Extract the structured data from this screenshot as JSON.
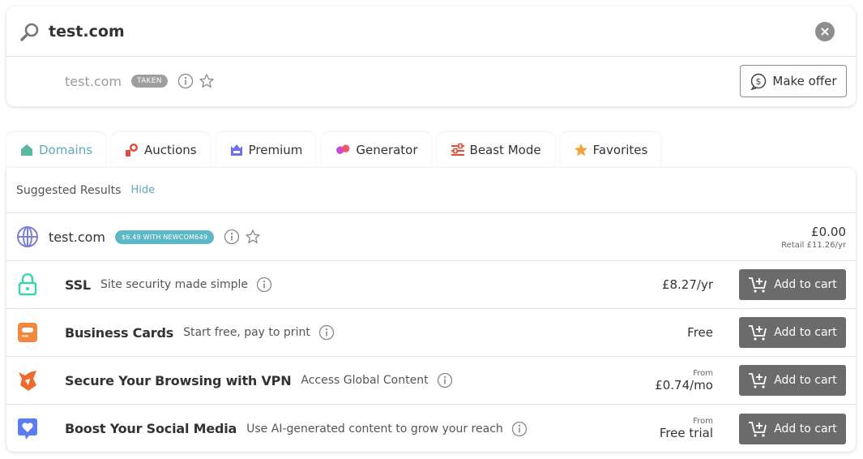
{
  "search": {
    "query": "test.com",
    "icons": {
      "search": "search-icon",
      "clear": "clear-icon"
    }
  },
  "exact_match": {
    "domain": "test.com",
    "status_badge": "TAKEN",
    "make_offer_label": "Make offer"
  },
  "tabs": [
    {
      "label": "Domains",
      "icon": "home-icon",
      "active": true
    },
    {
      "label": "Auctions",
      "icon": "auction-icon",
      "active": false
    },
    {
      "label": "Premium",
      "icon": "premium-icon",
      "active": false
    },
    {
      "label": "Generator",
      "icon": "generator-icon",
      "active": false
    },
    {
      "label": "Beast Mode",
      "icon": "sliders-icon",
      "active": false
    },
    {
      "label": "Favorites",
      "icon": "star-icon",
      "active": false
    }
  ],
  "suggested": {
    "title": "Suggested Results",
    "hide_label": "Hide",
    "domain": {
      "name": "test.com",
      "promo": "$6.49 WITH NEWCOM649",
      "price": "£0.00",
      "retail": "Retail £11.26/yr"
    },
    "products": [
      {
        "title": "SSL",
        "subtitle": "Site security made simple",
        "from": "",
        "price": "£8.27/yr",
        "cart_label": "Add to cart",
        "icon": "lock-icon"
      },
      {
        "title": "Business Cards",
        "subtitle": "Start free, pay to print",
        "from": "",
        "price": "Free",
        "cart_label": "Add to cart",
        "icon": "business-card-icon"
      },
      {
        "title": "Secure Your Browsing with VPN",
        "subtitle": "Access Global Content",
        "from": "From",
        "price": "£0.74/mo",
        "cart_label": "Add to cart",
        "icon": "vpn-fox-icon"
      },
      {
        "title": "Boost Your Social Media",
        "subtitle": "Use AI-generated content to grow your reach",
        "from": "From",
        "price": "Free trial",
        "cart_label": "Add to cart",
        "icon": "heart-chat-icon"
      }
    ]
  },
  "colors": {
    "accent": "#5fa8b8",
    "promo_badge": "#5bb8c4",
    "cart_button": "#6b6b6b",
    "taken_badge": "#9e9e9e"
  }
}
